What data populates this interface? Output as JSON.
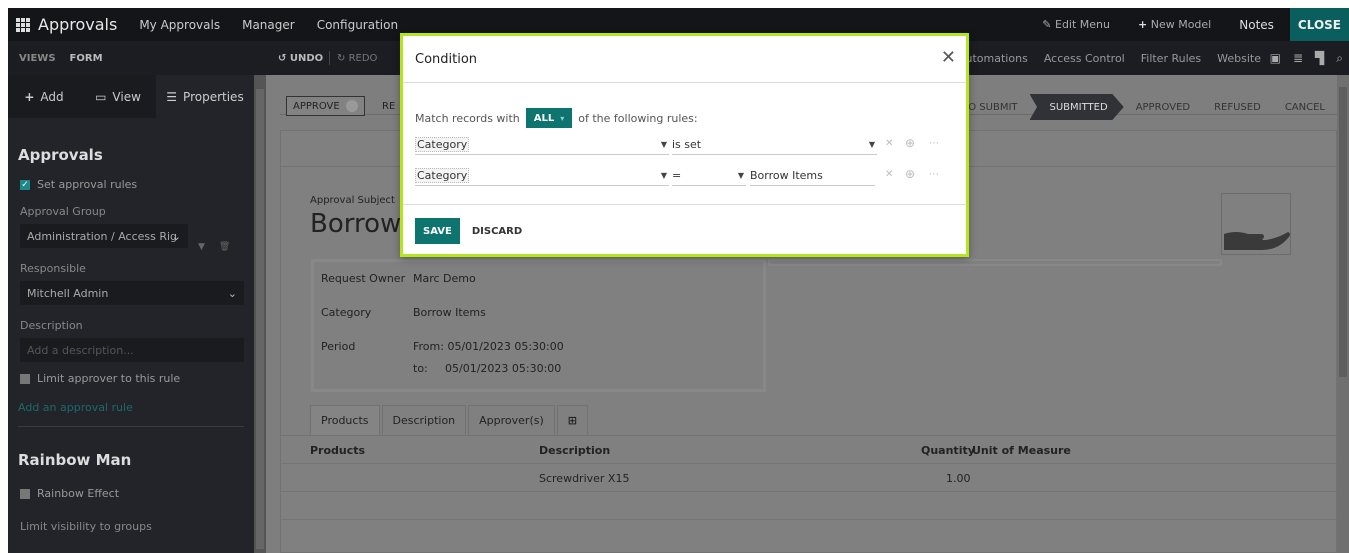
{
  "topnav": {
    "app_name": "Approvals",
    "menus": [
      "My Approvals",
      "Manager",
      "Configuration"
    ],
    "edit_menu": "Edit Menu",
    "new_model": "New Model",
    "notes": "Notes",
    "close": "CLOSE"
  },
  "subnav": {
    "views": "VIEWS",
    "form": "FORM",
    "undo": "UNDO",
    "redo": "REDO",
    "links": [
      "Automations",
      "Access Control",
      "Filter Rules",
      "Website"
    ]
  },
  "sidebar": {
    "tabs": {
      "add": "Add",
      "view": "View",
      "properties": "Properties"
    },
    "approvals_heading": "Approvals",
    "set_approval_rules": "Set approval rules",
    "approval_group_label": "Approval Group",
    "approval_group_value": "Administration / Access Rights",
    "responsible_label": "Responsible",
    "responsible_value": "Mitchell Admin",
    "description_label": "Description",
    "description_placeholder": "Add a description...",
    "limit_approver": "Limit approver to this rule",
    "add_rule_link": "Add an approval rule",
    "rainbow_heading": "Rainbow Man",
    "rainbow_effect": "Rainbow Effect",
    "limit_visibility": "Limit visibility to groups"
  },
  "form": {
    "approve_button": "APPROVE",
    "refuse_partial": "RE",
    "stages": [
      "TO SUBMIT",
      "SUBMITTED",
      "APPROVED",
      "REFUSED",
      "CANCEL"
    ],
    "active_stage": "SUBMITTED",
    "subject_label": "Approval Subject",
    "subject_title": "Borrow",
    "fields": {
      "request_owner_label": "Request Owner",
      "request_owner_value": "Marc Demo",
      "category_label": "Category",
      "category_value": "Borrow Items",
      "period_label": "Period",
      "period_from": "From: 05/01/2023 05:30:00",
      "period_to_label": "to:",
      "period_to_value": "05/01/2023 05:30:00"
    },
    "tabs": [
      "Products",
      "Description",
      "Approver(s)"
    ],
    "table": {
      "columns": [
        "Products",
        "Description",
        "Quantity",
        "Unit of Measure"
      ],
      "rows": [
        {
          "product": "",
          "description": "Screwdriver X15",
          "quantity": "1.00",
          "uom": ""
        }
      ]
    }
  },
  "modal": {
    "title": "Condition",
    "match_prefix": "Match records with",
    "match_mode": "ALL",
    "match_suffix": "of the following rules:",
    "rules": [
      {
        "field": "Category",
        "operator": "is set",
        "value": ""
      },
      {
        "field": "Category",
        "operator": "=",
        "value": "Borrow Items"
      }
    ],
    "save": "SAVE",
    "discard": "DISCARD"
  },
  "colors": {
    "accent": "#0e7470",
    "modal_border": "#b5e61d"
  }
}
